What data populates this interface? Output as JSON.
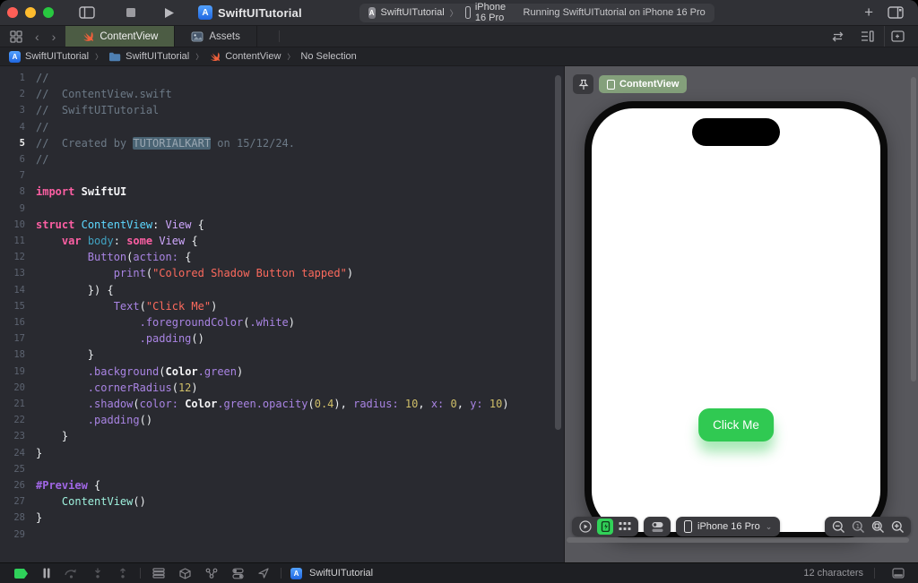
{
  "window": {
    "title": "SwiftUITutorial"
  },
  "toolbar": {
    "scheme_project": "SwiftUITutorial",
    "scheme_separator": "〉",
    "scheme_destination": "iPhone 16 Pro",
    "status_text": "Running SwiftUITutorial on iPhone 16 Pro",
    "app_icon_letter": "A"
  },
  "tabbar": {
    "tabs": [
      {
        "label": "ContentView",
        "icon": "swift-icon",
        "active": true
      },
      {
        "label": "Assets",
        "icon": "assets-icon",
        "active": false
      }
    ]
  },
  "breadcrumb": {
    "separator": "〉",
    "items": [
      {
        "label": "SwiftUITutorial",
        "icon": "project-icon"
      },
      {
        "label": "SwiftUITutorial",
        "icon": "folder-icon"
      },
      {
        "label": "ContentView",
        "icon": "swift-icon"
      },
      {
        "label": "No Selection",
        "icon": null
      }
    ]
  },
  "editor": {
    "current_line": 5,
    "lines": [
      {
        "n": 1,
        "t": [
          [
            "c",
            "//"
          ]
        ]
      },
      {
        "n": 2,
        "t": [
          [
            "c",
            "//  ContentView.swift"
          ]
        ]
      },
      {
        "n": 3,
        "t": [
          [
            "c",
            "//  SwiftUITutorial"
          ]
        ]
      },
      {
        "n": 4,
        "t": [
          [
            "c",
            "//"
          ]
        ]
      },
      {
        "n": 5,
        "t": [
          [
            "c",
            "//  Created by "
          ],
          [
            "chl",
            "TUTORIALKART"
          ],
          [
            "c",
            " on 15/12/24."
          ]
        ]
      },
      {
        "n": 6,
        "t": [
          [
            "c",
            "//"
          ]
        ]
      },
      {
        "n": 7,
        "t": []
      },
      {
        "n": 8,
        "t": [
          [
            "k",
            "import"
          ],
          [
            "pl",
            " "
          ],
          [
            "bw",
            "SwiftUI"
          ]
        ]
      },
      {
        "n": 9,
        "t": []
      },
      {
        "n": 10,
        "t": [
          [
            "k",
            "struct"
          ],
          [
            "pl",
            " "
          ],
          [
            "td",
            "ContentView"
          ],
          [
            "pl",
            ": "
          ],
          [
            "ty",
            "View"
          ],
          [
            "pl",
            " {"
          ]
        ]
      },
      {
        "n": 11,
        "t": [
          [
            "pl",
            "    "
          ],
          [
            "k",
            "var"
          ],
          [
            "pl",
            " "
          ],
          [
            "vd",
            "body"
          ],
          [
            "pl",
            ": "
          ],
          [
            "k",
            "some"
          ],
          [
            "pl",
            " "
          ],
          [
            "ty",
            "View"
          ],
          [
            "pl",
            " {"
          ]
        ]
      },
      {
        "n": 12,
        "t": [
          [
            "pl",
            "        "
          ],
          [
            "fn",
            "Button"
          ],
          [
            "pl",
            "("
          ],
          [
            "fn",
            "action:"
          ],
          [
            "pl",
            " {"
          ]
        ]
      },
      {
        "n": 13,
        "t": [
          [
            "pl",
            "            "
          ],
          [
            "fn",
            "print"
          ],
          [
            "pl",
            "("
          ],
          [
            "st",
            "\"Colored Shadow Button tapped\""
          ],
          [
            "pl",
            ")"
          ]
        ]
      },
      {
        "n": 14,
        "t": [
          [
            "pl",
            "        }) {"
          ]
        ]
      },
      {
        "n": 15,
        "t": [
          [
            "pl",
            "            "
          ],
          [
            "fn",
            "Text"
          ],
          [
            "pl",
            "("
          ],
          [
            "st",
            "\"Click Me\""
          ],
          [
            "pl",
            ")"
          ]
        ]
      },
      {
        "n": 16,
        "t": [
          [
            "pl",
            "                "
          ],
          [
            "fn",
            ".foregroundColor"
          ],
          [
            "pl",
            "("
          ],
          [
            "fn",
            ".white"
          ],
          [
            "pl",
            ")"
          ]
        ]
      },
      {
        "n": 17,
        "t": [
          [
            "pl",
            "                "
          ],
          [
            "fn",
            ".padding"
          ],
          [
            "pl",
            "()"
          ]
        ]
      },
      {
        "n": 18,
        "t": [
          [
            "pl",
            "        }"
          ]
        ]
      },
      {
        "n": 19,
        "t": [
          [
            "pl",
            "        "
          ],
          [
            "fn",
            ".background"
          ],
          [
            "pl",
            "("
          ],
          [
            "bw",
            "Color"
          ],
          [
            "fn",
            ".green"
          ],
          [
            "pl",
            ")"
          ]
        ]
      },
      {
        "n": 20,
        "t": [
          [
            "pl",
            "        "
          ],
          [
            "fn",
            ".cornerRadius"
          ],
          [
            "pl",
            "("
          ],
          [
            "nu",
            "12"
          ],
          [
            "pl",
            ")"
          ]
        ]
      },
      {
        "n": 21,
        "t": [
          [
            "pl",
            "        "
          ],
          [
            "fn",
            ".shadow"
          ],
          [
            "pl",
            "("
          ],
          [
            "fn",
            "color:"
          ],
          [
            "pl",
            " "
          ],
          [
            "bw",
            "Color"
          ],
          [
            "fn",
            ".green"
          ],
          [
            "fn",
            ".opacity"
          ],
          [
            "pl",
            "("
          ],
          [
            "nu",
            "0.4"
          ],
          [
            "pl",
            "), "
          ],
          [
            "fn",
            "radius:"
          ],
          [
            "pl",
            " "
          ],
          [
            "nu",
            "10"
          ],
          [
            "pl",
            ", "
          ],
          [
            "fn",
            "x:"
          ],
          [
            "pl",
            " "
          ],
          [
            "nu",
            "0"
          ],
          [
            "pl",
            ", "
          ],
          [
            "fn",
            "y:"
          ],
          [
            "pl",
            " "
          ],
          [
            "nu",
            "10"
          ],
          [
            "pl",
            ")"
          ]
        ]
      },
      {
        "n": 22,
        "t": [
          [
            "pl",
            "        "
          ],
          [
            "fn",
            ".padding"
          ],
          [
            "pl",
            "()"
          ]
        ]
      },
      {
        "n": 23,
        "t": [
          [
            "pl",
            "    }"
          ]
        ]
      },
      {
        "n": 24,
        "t": [
          [
            "pl",
            "}"
          ]
        ]
      },
      {
        "n": 25,
        "t": []
      },
      {
        "n": 26,
        "t": [
          [
            "mc",
            "#Preview"
          ],
          [
            "pl",
            " {"
          ]
        ]
      },
      {
        "n": 27,
        "t": [
          [
            "pl",
            "    "
          ],
          [
            "mg",
            "ContentView"
          ],
          [
            "pl",
            "()"
          ]
        ]
      },
      {
        "n": 28,
        "t": [
          [
            "pl",
            "}"
          ]
        ]
      },
      {
        "n": 29,
        "t": []
      }
    ]
  },
  "preview": {
    "badge_label": "ContentView",
    "badge_color": "#84a07b",
    "button_label": "Click Me",
    "button_color": "#30c952",
    "destination_label": "iPhone 16 Pro",
    "destination_chevron": "⌄"
  },
  "debugbar": {
    "project_label": "SwiftUITutorial",
    "char_count": "12 characters"
  },
  "colors": {
    "accent_green": "#30c952",
    "tab_active": "#4c5c44",
    "keyword_pink": "#fc5fa3",
    "string_red": "#fc6a5d",
    "number_yellow": "#d0bf69",
    "function_purple": "#a984e3",
    "comment_gray": "#6c7986",
    "editor_bg": "#292a30",
    "canvas_bg": "#57575c"
  }
}
